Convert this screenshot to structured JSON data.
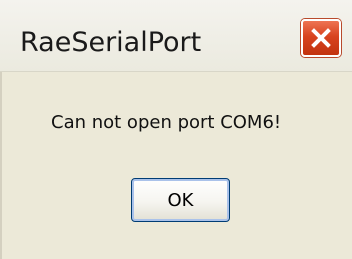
{
  "window": {
    "title": "RaeSerialPort",
    "close_icon": "close-icon"
  },
  "dialog": {
    "message": "Can not open port COM6!",
    "ok_label": "OK"
  },
  "colors": {
    "dialog_background": "#ece9d8",
    "close_button": "#d8431f",
    "ok_border": "#003c74"
  }
}
